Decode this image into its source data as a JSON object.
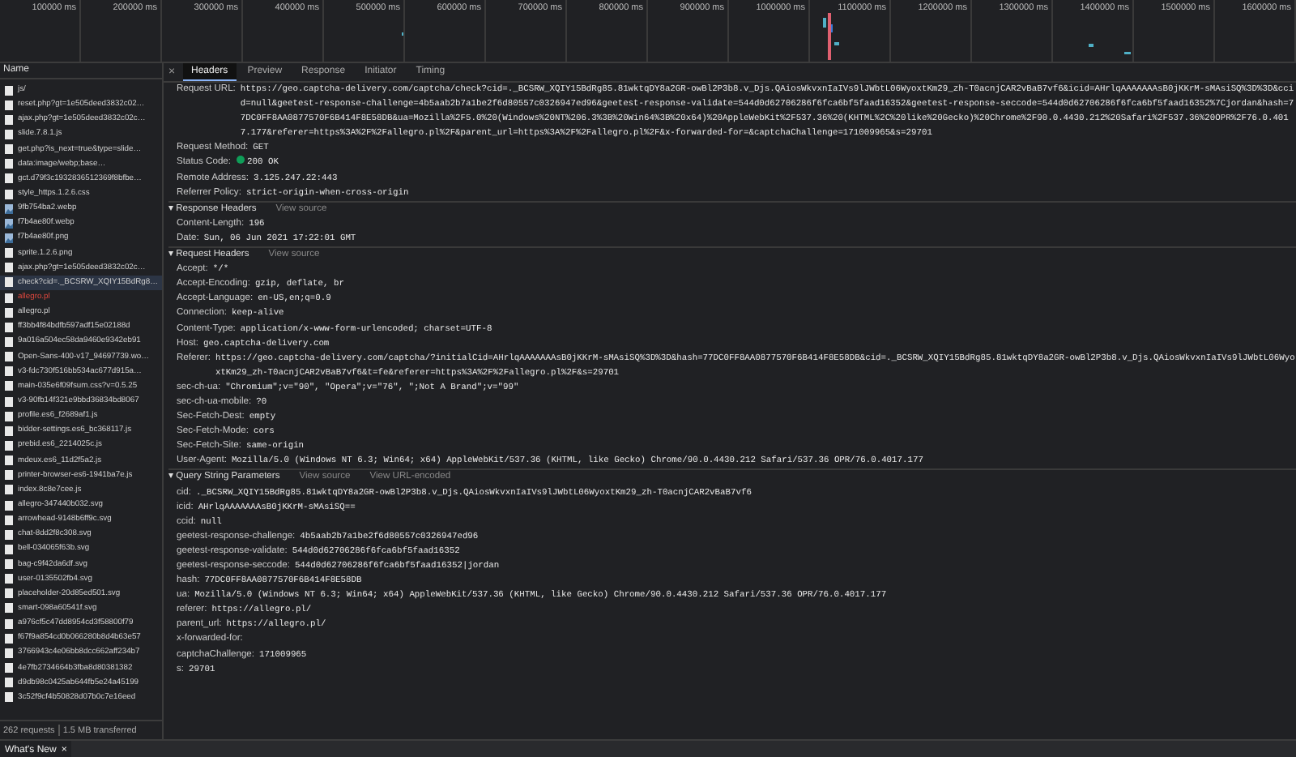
{
  "timeline": {
    "ticks": [
      "100000 ms",
      "200000 ms",
      "300000 ms",
      "400000 ms",
      "500000 ms",
      "600000 ms",
      "700000 ms",
      "800000 ms",
      "900000 ms",
      "1000000 ms",
      "1100000 ms",
      "1200000 ms",
      "1300000 ms",
      "1400000 ms",
      "1500000 ms",
      "1600000 ms"
    ]
  },
  "requests": {
    "header": "Name",
    "items": [
      {
        "name": "js/",
        "kind": "document",
        "failed": false,
        "selected": false
      },
      {
        "name": "reset.php?gt=1e505deed3832c02…",
        "kind": "document",
        "failed": false,
        "selected": false
      },
      {
        "name": "ajax.php?gt=1e505deed3832c02c…",
        "kind": "document",
        "failed": false,
        "selected": false
      },
      {
        "name": "slide.7.8.1.js",
        "kind": "document",
        "failed": false,
        "selected": false
      },
      {
        "name": "get.php?is_next=true&type=slide…",
        "kind": "document",
        "failed": false,
        "selected": false
      },
      {
        "name": "data:image/webp;base…",
        "kind": "document",
        "failed": false,
        "selected": false
      },
      {
        "name": "gct.d79f3c1932836512369f8bfbe…",
        "kind": "document",
        "failed": false,
        "selected": false
      },
      {
        "name": "style_https.1.2.6.css",
        "kind": "document",
        "failed": false,
        "selected": false
      },
      {
        "name": "9fb754ba2.webp",
        "kind": "image",
        "failed": false,
        "selected": false
      },
      {
        "name": "f7b4ae80f.webp",
        "kind": "image",
        "failed": false,
        "selected": false
      },
      {
        "name": "f7b4ae80f.png",
        "kind": "image",
        "failed": false,
        "selected": false
      },
      {
        "name": "sprite.1.2.6.png",
        "kind": "document",
        "failed": false,
        "selected": false
      },
      {
        "name": "ajax.php?gt=1e505deed3832c02c…",
        "kind": "document",
        "failed": false,
        "selected": false
      },
      {
        "name": "check?cid=._BCSRW_XQIY15BdRg8…",
        "kind": "document",
        "failed": false,
        "selected": true
      },
      {
        "name": "allegro.pl",
        "kind": "document",
        "failed": true,
        "selected": false
      },
      {
        "name": "allegro.pl",
        "kind": "document",
        "failed": false,
        "selected": false
      },
      {
        "name": "ff3bb4f84bdfb597adf15e02188d",
        "kind": "document",
        "failed": false,
        "selected": false
      },
      {
        "name": "9a016a504ec58da9460e9342eb91",
        "kind": "document",
        "failed": false,
        "selected": false
      },
      {
        "name": "Open-Sans-400-v17_94697739.wo…",
        "kind": "document",
        "failed": false,
        "selected": false
      },
      {
        "name": "v3-fdc730f516bb534ac677d915a…",
        "kind": "document",
        "failed": false,
        "selected": false
      },
      {
        "name": "main-035e6f09fsum.css?v=0.5.25",
        "kind": "document",
        "failed": false,
        "selected": false
      },
      {
        "name": "v3-90fb14f321e9bbd36834bd8067",
        "kind": "document",
        "failed": false,
        "selected": false
      },
      {
        "name": "profile.es6_f2689af1.js",
        "kind": "document",
        "failed": false,
        "selected": false
      },
      {
        "name": "bidder-settings.es6_bc368117.js",
        "kind": "document",
        "failed": false,
        "selected": false
      },
      {
        "name": "prebid.es6_2214025c.js",
        "kind": "document",
        "failed": false,
        "selected": false
      },
      {
        "name": "mdeux.es6_11d2f5a2.js",
        "kind": "document",
        "failed": false,
        "selected": false
      },
      {
        "name": "printer-browser-es6-1941ba7e.js",
        "kind": "document",
        "failed": false,
        "selected": false
      },
      {
        "name": "index.8c8e7cee.js",
        "kind": "document",
        "failed": false,
        "selected": false
      },
      {
        "name": "allegro-347440b032.svg",
        "kind": "document",
        "failed": false,
        "selected": false
      },
      {
        "name": "arrowhead-9148b6ff9c.svg",
        "kind": "document",
        "failed": false,
        "selected": false
      },
      {
        "name": "chat-8dd2f8c308.svg",
        "kind": "document",
        "failed": false,
        "selected": false
      },
      {
        "name": "bell-034065f63b.svg",
        "kind": "document",
        "failed": false,
        "selected": false
      },
      {
        "name": "bag-c9f42da6df.svg",
        "kind": "document",
        "failed": false,
        "selected": false
      },
      {
        "name": "user-0135502fb4.svg",
        "kind": "document",
        "failed": false,
        "selected": false
      },
      {
        "name": "placeholder-20d85ed501.svg",
        "kind": "document",
        "failed": false,
        "selected": false
      },
      {
        "name": "smart-098a60541f.svg",
        "kind": "document",
        "failed": false,
        "selected": false
      },
      {
        "name": "a976cf5c47dd8954cd3f58800f79",
        "kind": "document",
        "failed": false,
        "selected": false
      },
      {
        "name": "f67f9a854cd0b066280b8d4b63e57",
        "kind": "document",
        "failed": false,
        "selected": false
      },
      {
        "name": "3766943c4e06bb8dcc662aff234b7",
        "kind": "document",
        "failed": false,
        "selected": false
      },
      {
        "name": "4e7fb2734664b3fba8d80381382",
        "kind": "document",
        "failed": false,
        "selected": false
      },
      {
        "name": "d9db98c0425ab644fb5e24a45199",
        "kind": "document",
        "failed": false,
        "selected": false
      },
      {
        "name": "3c52f9cf4b50828d07b0c7e16eed",
        "kind": "document",
        "failed": false,
        "selected": false
      }
    ],
    "summary": [
      "262 requests",
      "1.5 MB transferred"
    ]
  },
  "details": {
    "close": "×",
    "tabs": [
      {
        "label": "Headers",
        "selected": true
      },
      {
        "label": "Preview",
        "selected": false
      },
      {
        "label": "Response",
        "selected": false
      },
      {
        "label": "Initiator",
        "selected": false
      },
      {
        "label": "Timing",
        "selected": false
      }
    ],
    "general": [
      {
        "key": "Request URL:",
        "value": "https://geo.captcha-delivery.com/captcha/check?cid=._BCSRW_XQIY15BdRg85.81wktqDY8a2GR-owBl2P3b8.v_Djs.QAiosWkvxnIaIVs9lJWbtL06WyoxtKm29_zh-T0acnjCAR2vBaB7vf6&icid=AHrlqAAAAAAAsB0jKKrM-sMAsiSQ%3D%3D&ccid=null&geetest-response-challenge=4b5aab2b7a1be2f6d80557c0326947ed96&geetest-response-validate=544d0d62706286f6fca6bf5faad16352&geetest-response-seccode=544d0d62706286f6fca6bf5faad16352%7Cjordan&hash=77DC0FF8AA0877570F6B414F8E58DB&ua=Mozilla%2F5.0%20(Windows%20NT%206.3%3B%20Win64%3B%20x64)%20AppleWebKit%2F537.36%20(KHTML%2C%20like%20Gecko)%20Chrome%2F90.0.4430.212%20Safari%2F537.36%20OPR%2F76.0.4017.177&referer=https%3A%2F%2Fallegro.pl%2F&parent_url=https%3A%2F%2Fallegro.pl%2F&x-forwarded-for=&captchaChallenge=171009965&s=29701",
        "kind": "text"
      },
      {
        "key": "Request Method:",
        "value": "GET",
        "kind": "text"
      },
      {
        "key": "Status Code:",
        "value": "200 OK",
        "kind": "status",
        "color": "#0f9d58"
      },
      {
        "key": "Remote Address:",
        "value": "3.125.247.22:443",
        "kind": "text"
      },
      {
        "key": "Referrer Policy:",
        "value": "strict-origin-when-cross-origin",
        "kind": "text"
      }
    ],
    "sections": [
      {
        "toggle": "▾",
        "title": "Response Headers",
        "links": [
          "View source"
        ],
        "rows": [
          {
            "key": "Content-Length:",
            "value": "196"
          },
          {
            "key": "Date:",
            "value": "Sun, 06 Jun 2021 17:22:01 GMT"
          }
        ]
      },
      {
        "toggle": "▾",
        "title": "Request Headers",
        "links": [
          "View source"
        ],
        "rows": [
          {
            "key": "Accept:",
            "value": "*/*"
          },
          {
            "key": "Accept-Encoding:",
            "value": "gzip, deflate, br"
          },
          {
            "key": "Accept-Language:",
            "value": "en-US,en;q=0.9"
          },
          {
            "key": "Connection:",
            "value": "keep-alive"
          },
          {
            "key": "Content-Type:",
            "value": "application/x-www-form-urlencoded; charset=UTF-8"
          },
          {
            "key": "Host:",
            "value": "geo.captcha-delivery.com"
          },
          {
            "key": "Referer:",
            "value": "https://geo.captcha-delivery.com/captcha/?initialCid=AHrlqAAAAAAAsB0jKKrM-sMAsiSQ%3D%3D&hash=77DC0FF8AA0877570F6B414F8E58DB&cid=._BCSRW_XQIY15BdRg85.81wktqDY8a2GR-owBl2P3b8.v_Djs.QAiosWkvxnIaIVs9lJWbtL06WyoxtKm29_zh-T0acnjCAR2vBaB7vf6&t=fe&referer=https%3A%2F%2Fallegro.pl%2F&s=29701"
          },
          {
            "key": "sec-ch-ua:",
            "value": "\"Chromium\";v=\"90\", \"Opera\";v=\"76\", \";Not A Brand\";v=\"99\""
          },
          {
            "key": "sec-ch-ua-mobile:",
            "value": "?0"
          },
          {
            "key": "Sec-Fetch-Dest:",
            "value": "empty"
          },
          {
            "key": "Sec-Fetch-Mode:",
            "value": "cors"
          },
          {
            "key": "Sec-Fetch-Site:",
            "value": "same-origin"
          },
          {
            "key": "User-Agent:",
            "value": "Mozilla/5.0 (Windows NT 6.3; Win64; x64) AppleWebKit/537.36 (KHTML, like Gecko) Chrome/90.0.4430.212 Safari/537.36 OPR/76.0.4017.177"
          }
        ]
      },
      {
        "toggle": "▾",
        "title": "Query String Parameters",
        "links": [
          "View source",
          "View URL-encoded"
        ],
        "rows": [
          {
            "key": "cid:",
            "value": "._BCSRW_XQIY15BdRg85.81wktqDY8a2GR-owBl2P3b8.v_Djs.QAiosWkvxnIaIVs9lJWbtL06WyoxtKm29_zh-T0acnjCAR2vBaB7vf6"
          },
          {
            "key": "icid:",
            "value": "AHrlqAAAAAAAsB0jKKrM-sMAsiSQ=="
          },
          {
            "key": "ccid:",
            "value": "null"
          },
          {
            "key": "geetest-response-challenge:",
            "value": "4b5aab2b7a1be2f6d80557c0326947ed96"
          },
          {
            "key": "geetest-response-validate:",
            "value": "544d0d62706286f6fca6bf5faad16352"
          },
          {
            "key": "geetest-response-seccode:",
            "value": "544d0d62706286f6fca6bf5faad16352|jordan"
          },
          {
            "key": "hash:",
            "value": "77DC0FF8AA0877570F6B414F8E58DB"
          },
          {
            "key": "ua:",
            "value": "Mozilla/5.0 (Windows NT 6.3; Win64; x64) AppleWebKit/537.36 (KHTML, like Gecko) Chrome/90.0.4430.212 Safari/537.36 OPR/76.0.4017.177"
          },
          {
            "key": "referer:",
            "value": "https://allegro.pl/"
          },
          {
            "key": "parent_url:",
            "value": "https://allegro.pl/"
          },
          {
            "key": "x-forwarded-for:",
            "value": ""
          },
          {
            "key": "captchaChallenge:",
            "value": "171009965"
          },
          {
            "key": "s:",
            "value": "29701"
          }
        ]
      }
    ]
  },
  "drawer": {
    "tab": "What's New",
    "close": "×"
  }
}
